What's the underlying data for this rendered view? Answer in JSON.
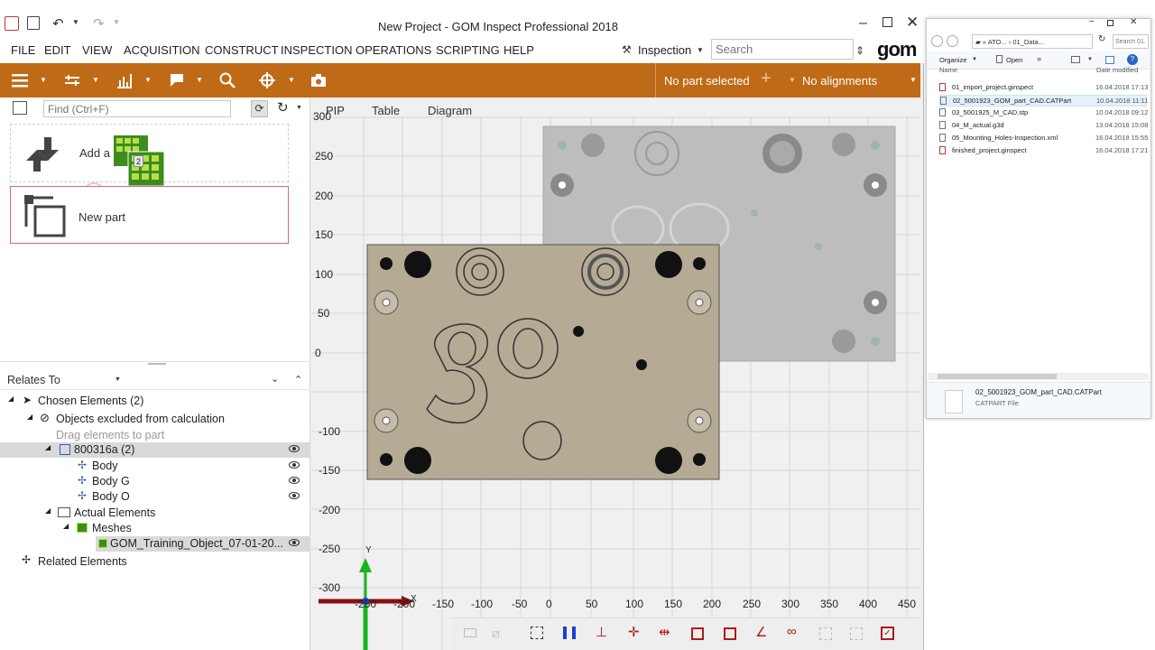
{
  "window": {
    "title": "New Project - GOM Inspect Professional 2018"
  },
  "menu": {
    "items": [
      "FILE",
      "EDIT",
      "VIEW",
      "ACQUISITION",
      "CONSTRUCT",
      "INSPECTION",
      "OPERATIONS",
      "SCRIPTING",
      "HELP"
    ],
    "workspace": "Inspection",
    "search_placeholder": "Search",
    "logo": "gom"
  },
  "toolbar": {
    "part_status": "No part selected",
    "alignment_status": "No alignments"
  },
  "left_panel": {
    "find_placeholder": "Find (Ctrl+F)",
    "add_tile_label": "Add a",
    "drag_badge": "2",
    "new_part_label": "New part",
    "relates_to": "Relates To",
    "tree": {
      "chosen": "Chosen Elements (2)",
      "excluded": "Objects excluded from calculation",
      "drag_hint": "Drag elements to part",
      "part": "800316a (2)",
      "body": "Body",
      "body_g": "Body G",
      "body_o": "Body O",
      "actual": "Actual Elements",
      "meshes": "Meshes",
      "mesh": "GOM_Training_Object_07-01-20...",
      "related": "Related Elements"
    },
    "collapse_glyph": "«"
  },
  "viewport": {
    "tabs": [
      "PIP",
      "Table",
      "Diagram"
    ],
    "y_ticks": [
      "300",
      "250",
      "200",
      "150",
      "100",
      "50",
      "0",
      "-100",
      "-150",
      "-200",
      "-250",
      "-300"
    ],
    "x_ticks": [
      "-250",
      "-200",
      "-150",
      "-100",
      "-50",
      "0",
      "50",
      "100",
      "150",
      "200",
      "250",
      "300",
      "350",
      "400",
      "450"
    ],
    "axis_y": "Y",
    "axis_x": "X"
  },
  "explorer": {
    "breadcrumb_1": "ATO...",
    "breadcrumb_2": "01_Data...",
    "search_placeholder": "Search 01...",
    "organize": "Organize",
    "open": "Open",
    "col_name": "Name",
    "col_date": "Date modified",
    "files": [
      {
        "name": "01_import_project.ginspect",
        "date": "16.04.2018 17:13"
      },
      {
        "name": "02_5001923_GOM_part_CAD.CATPart",
        "date": "10.04.2018 11:11"
      },
      {
        "name": "03_5001925_M_CAD.stp",
        "date": "10.04.2018 09:12"
      },
      {
        "name": "04_M_actual.g3d",
        "date": "13.04.2018 15:08"
      },
      {
        "name": "05_Mounting_Holes-Inspection.xml",
        "date": "16.04.2018 15:55"
      },
      {
        "name": "finished_project.ginspect",
        "date": "16.04.2018 17:21"
      }
    ],
    "details_name": "02_5001923_GOM_part_CAD.CATPart",
    "details_type": "CATPART File"
  },
  "colors": {
    "toolbar": "#bf6a17",
    "part_fill": "#b5aa94",
    "ghost_fill": "#bdbdbd",
    "selection": "#d9d9d9"
  }
}
